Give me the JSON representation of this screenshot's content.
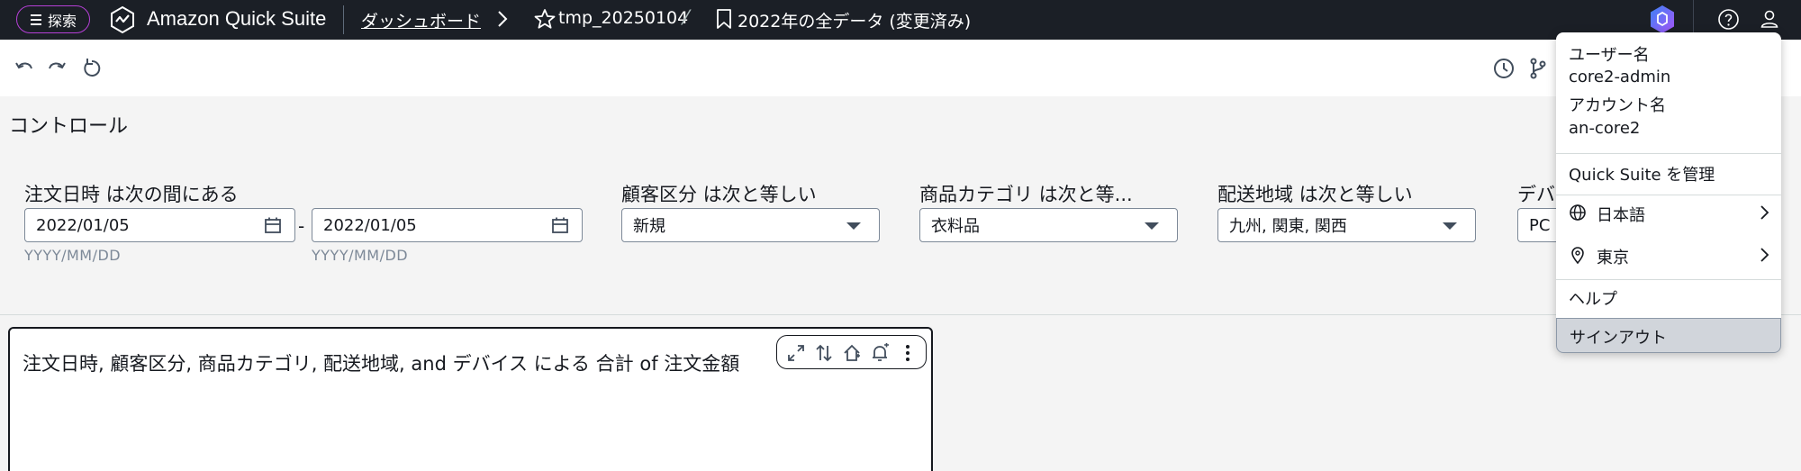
{
  "topbar": {
    "explore_label": "探索",
    "brand_name": "Amazon Quick Suite",
    "dashboard_link": "ダッシュボード",
    "analysis_name": "tmp_20250104",
    "sheet_name": "2022年の全データ (変更済み)"
  },
  "controls": {
    "title": "コントロール",
    "date_label": "注文日時 は次の間にある",
    "date_from": "2022/01/05",
    "date_to": "2022/01/05",
    "date_hint_from": "YYYY/MM/DD",
    "date_hint_to": "YYYY/MM/DD",
    "segment_label": "顧客区分 は次と等しい",
    "segment_value": "新規",
    "category_label": "商品カテゴリ は次と等...",
    "category_value": "衣料品",
    "region_label": "配送地域 は次と等しい",
    "region_value": "九州, 関東, 関西",
    "device_label": "デバ",
    "device_value": "PC"
  },
  "visual": {
    "title": "注文日時, 顧客区分, 商品カテゴリ, 配送地域, and デバイス による 合計 of 注文金額"
  },
  "user_menu": {
    "username_label": "ユーザー名",
    "username": "core2-admin",
    "account_label": "アカウント名",
    "account": "an-core2",
    "manage": "Quick Suite を管理",
    "language": "日本語",
    "region": "東京",
    "help": "ヘルプ",
    "signout": "サインアウト"
  },
  "colors": {
    "topbar_bg": "#1b1f26",
    "explore_border": "#b53fd6",
    "signout_highlight": "#d1d5db"
  }
}
